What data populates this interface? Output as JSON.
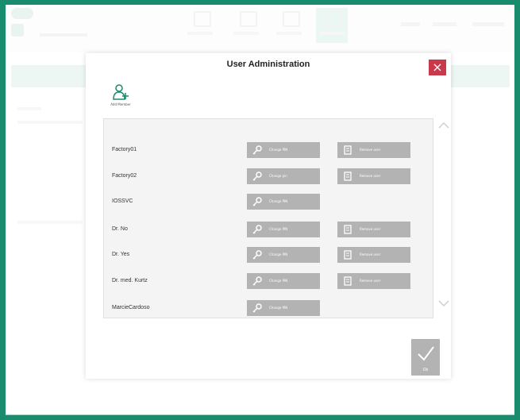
{
  "dialog": {
    "title": "User Administration",
    "close_label": "×",
    "add_member_label": "Add Member",
    "ok_label": "Ok"
  },
  "users": [
    {
      "name": "Factory01",
      "pin_label": "Change PIN",
      "remove_label": "Remove user",
      "has_remove": true
    },
    {
      "name": "Factory02",
      "pin_label": "Change pin",
      "remove_label": "Remove user",
      "has_remove": true
    },
    {
      "name": "IOSSVC",
      "pin_label": "Change PIN",
      "remove_label": "",
      "has_remove": false
    },
    {
      "name": "Dr. No",
      "pin_label": "Change PIN",
      "remove_label": "Remove user",
      "has_remove": true
    },
    {
      "name": "Dr. Yes",
      "pin_label": "Change PIN",
      "remove_label": "Remove user",
      "has_remove": true
    },
    {
      "name": "Dr. med. Kurtz",
      "pin_label": "Change PIN",
      "remove_label": "Remove user",
      "has_remove": true
    },
    {
      "name": "MarcieCardoso",
      "pin_label": "Change PIN",
      "remove_label": "",
      "has_remove": false
    }
  ],
  "colors": {
    "frame": "#1a8c6e",
    "close": "#c8394b",
    "button": "#b3b3b3",
    "panel": "#f4f4f4"
  },
  "icons": {
    "close": "close-icon",
    "add_member": "add-member-icon",
    "pin": "key-icon",
    "remove": "remove-user-icon",
    "ok": "checkmark-icon",
    "scroll_up": "chevron-up-icon",
    "scroll_down": "chevron-down-icon"
  }
}
